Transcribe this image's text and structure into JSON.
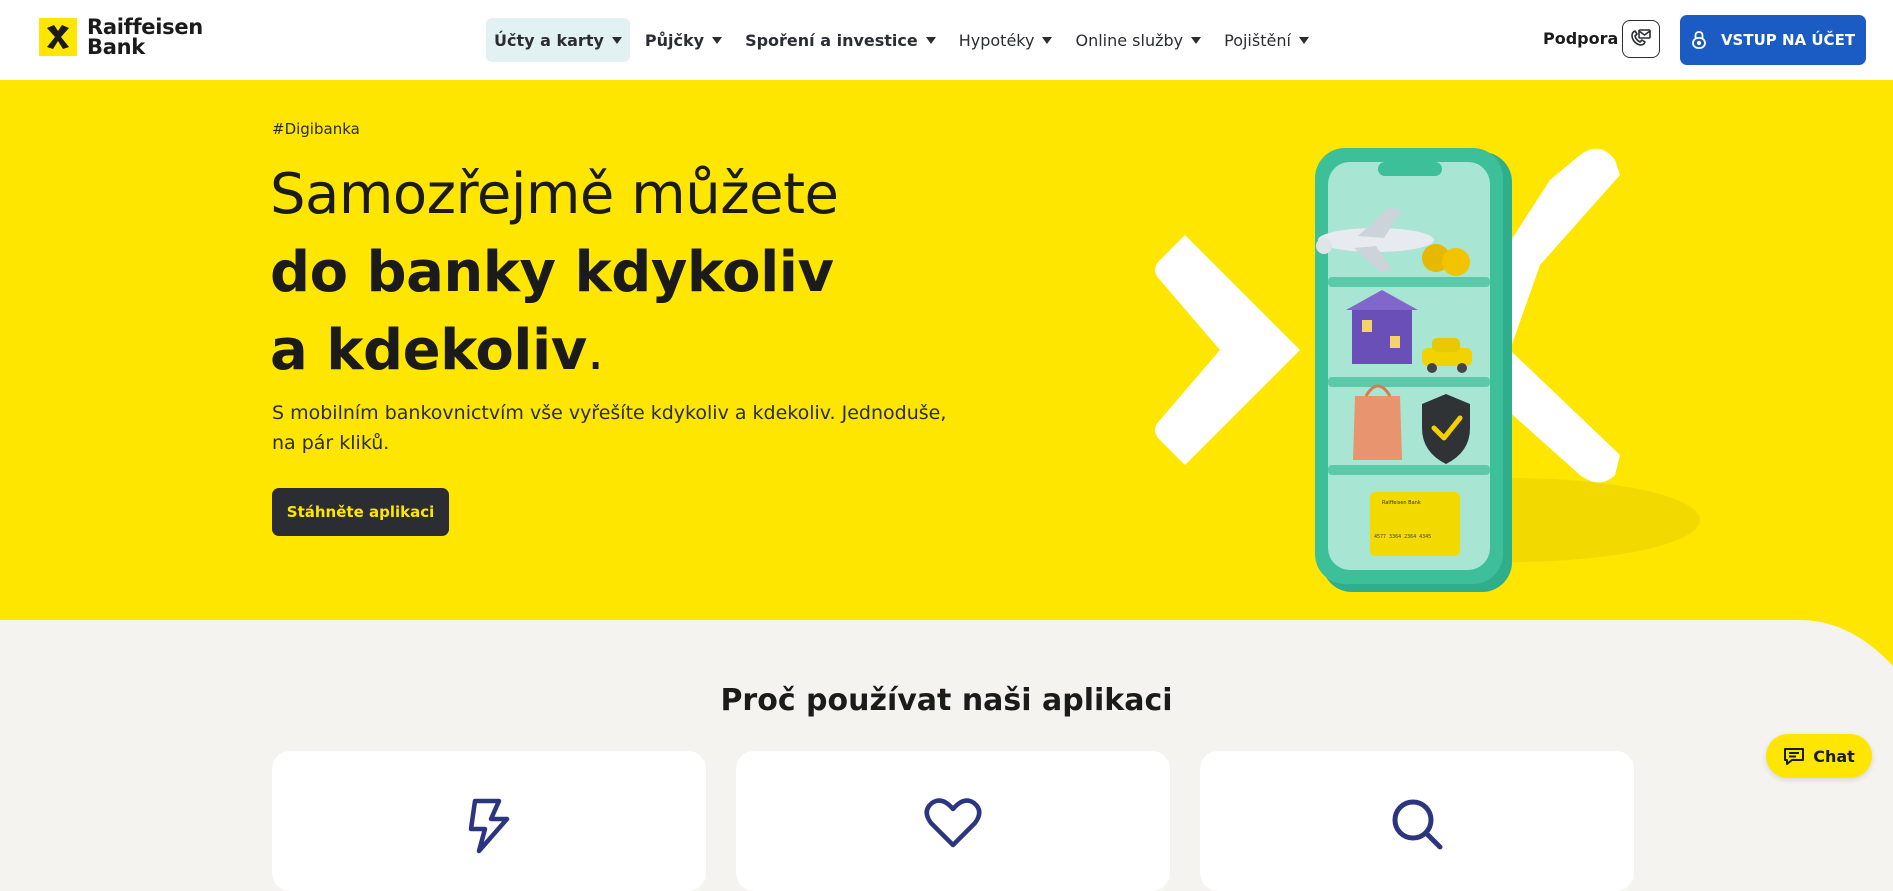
{
  "brand": {
    "name_line1": "Raiffeisen",
    "name_line2": "Bank",
    "icon": "raiffeisen-logo-icon"
  },
  "nav": {
    "items": [
      {
        "label": "Účty a karty"
      },
      {
        "label": "Půjčky"
      },
      {
        "label": "Spoření a investice"
      },
      {
        "label": "Hypotéky"
      },
      {
        "label": "Online služby"
      },
      {
        "label": "Pojištění"
      }
    ],
    "active_index": 0
  },
  "header": {
    "support_label": "Podpora",
    "contact_icon": "phone-envelope-icon",
    "login_label": "VSTUP NA ÚČET",
    "login_icon": "lock-icon"
  },
  "hero": {
    "tag": "#Digibanka",
    "title_line1": "Samozřejmě můžete",
    "title_line2": "do banky kdykoliv",
    "title_line3": "a kdekoliv",
    "title_dot": ".",
    "description": "S mobilním bankovnictvím vše vyřešíte kdykoliv a kdekoliv. Jednoduše, na pár kliků.",
    "cta_label": "Stáhněte aplikaci",
    "card_brand": "Raiffeisen Bank",
    "card_number": "4577 3364 2364 4345"
  },
  "section": {
    "title": "Proč používat naši aplikaci",
    "cards": [
      {
        "icon": "lightning-icon"
      },
      {
        "icon": "heart-icon"
      },
      {
        "icon": "search-icon"
      }
    ]
  },
  "chat": {
    "label": "Chat",
    "icon": "chat-icon"
  },
  "colors": {
    "brand_yellow": "#fee600",
    "login_blue": "#1a5bc4",
    "dark": "#2b2d33",
    "icon_navy": "#2b3580",
    "phone_green": "#3dbf99"
  }
}
